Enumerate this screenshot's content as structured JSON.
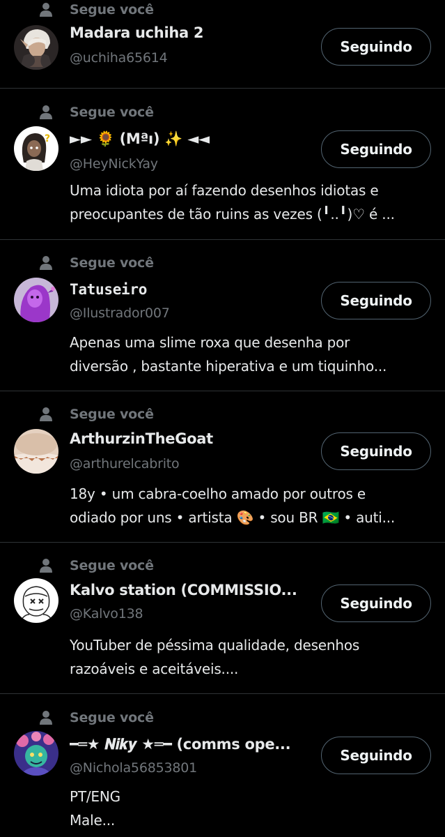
{
  "follows_you_label": "Segue você",
  "button_label": "Seguindo",
  "accounts": [
    {
      "name": "Madara uchiha 2",
      "handle": "@uchiha65614",
      "bio": []
    },
    {
      "name": "►► 🌻 (Mªı) ✨ ◄◄",
      "handle": "@HeyNickYay",
      "bio": [
        "Uma idiota por aí fazendo desenhos idiotas e",
        "preocupantes de tão ruins as vezes (╹..╹)♡  é ..."
      ]
    },
    {
      "name": "Tatuseiro",
      "handle": "@Ilustrador007",
      "bio": [
        "Apenas uma slime roxa que desenha por",
        "diversão , bastante hiperativa e um tiquinho..."
      ]
    },
    {
      "name": "ArthurzinTheGoat",
      "handle": "@arthurelcabrito",
      "bio": [
        "18y • um cabra-coelho amado por outros e",
        "odiado por uns • artista 🎨 • sou BR 🇧🇷 • auti..."
      ]
    },
    {
      "name": "Kalvo station (COMMISSIO...",
      "handle": "@Kalvo138",
      "bio": [
        "YouTuber de péssima qualidade, desenhos",
        "razoáveis e aceitáveis...."
      ]
    },
    {
      "name": "━═★ 𝑵𝒊𝒌𝒚 ★═━ (comms ope...",
      "handle": "@Nichola56853801",
      "bio": [
        "PT/ENG",
        "Male..."
      ]
    }
  ]
}
